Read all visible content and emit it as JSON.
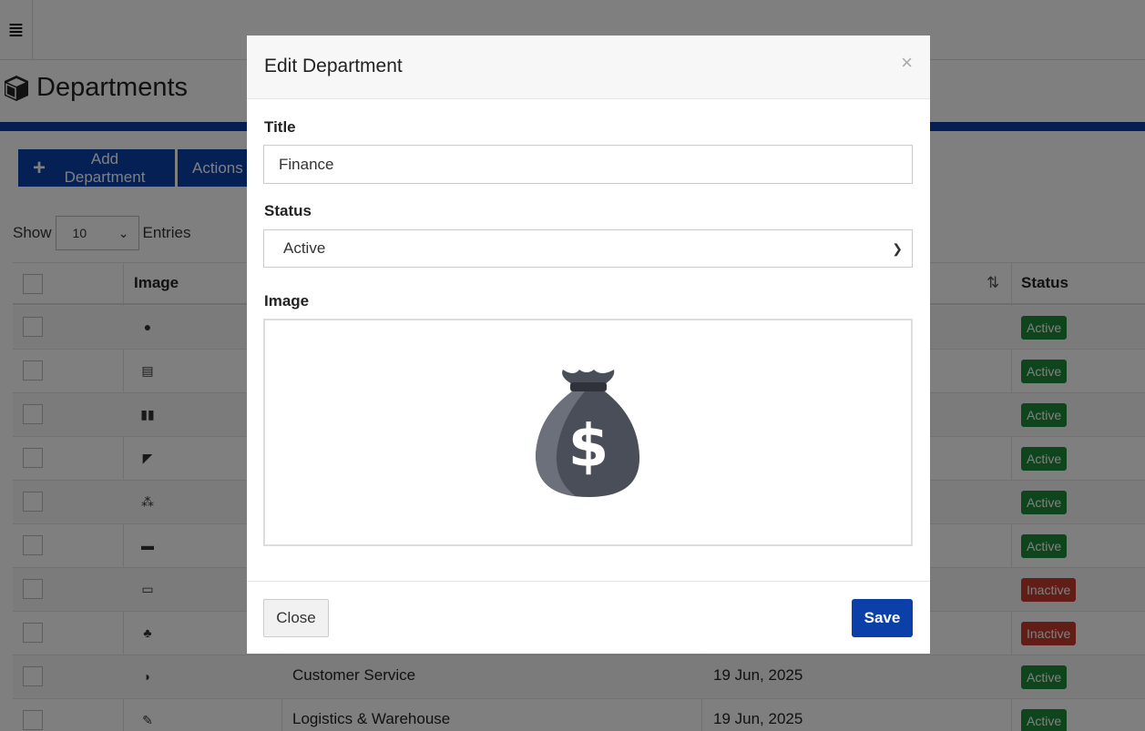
{
  "page": {
    "title": "Departments",
    "add_button": "Add Department",
    "actions_button": "Actions",
    "show_label": "Show",
    "entries_value": "10",
    "entries_label": "Entries"
  },
  "table": {
    "headers": {
      "image": "Image",
      "status": "Status"
    },
    "rows": [
      {
        "icon": "bag-icon",
        "glyph": "●",
        "title": "",
        "date": "",
        "status": "Active"
      },
      {
        "icon": "server-icon",
        "glyph": "▤",
        "title": "",
        "date": "",
        "status": "Active"
      },
      {
        "icon": "pause-icon",
        "glyph": "▮▮",
        "title": "",
        "date": "",
        "status": "Active"
      },
      {
        "icon": "megaphone-icon",
        "glyph": "◤",
        "title": "",
        "date": "",
        "status": "Active"
      },
      {
        "icon": "org-chart-icon",
        "glyph": "⁂",
        "title": "",
        "date": "",
        "status": "Active"
      },
      {
        "icon": "printer-icon",
        "glyph": "▬",
        "title": "",
        "date": "",
        "status": "Active"
      },
      {
        "icon": "monitor-icon",
        "glyph": "▭",
        "title": "",
        "date": "",
        "status": "Inactive"
      },
      {
        "icon": "plant-icon",
        "glyph": "♣",
        "title": "",
        "date": "",
        "status": "Inactive"
      },
      {
        "icon": "headset-icon",
        "glyph": "◗",
        "title": "Customer Service",
        "date": "19 Jun, 2025",
        "status": "Active"
      },
      {
        "icon": "wrench-icon",
        "glyph": "✎",
        "title": "Logistics & Warehouse",
        "date": "19 Jun, 2025",
        "status": "Active"
      }
    ]
  },
  "modal": {
    "title": "Edit Department",
    "close_symbol": "×",
    "title_label": "Title",
    "title_value": "Finance",
    "status_label": "Status",
    "status_value": "Active",
    "image_label": "Image",
    "close_button": "Close",
    "save_button": "Save"
  },
  "colors": {
    "brand": "#0a40a8",
    "active_badge": "#1f8a3a",
    "inactive_badge": "#c23a2c"
  }
}
